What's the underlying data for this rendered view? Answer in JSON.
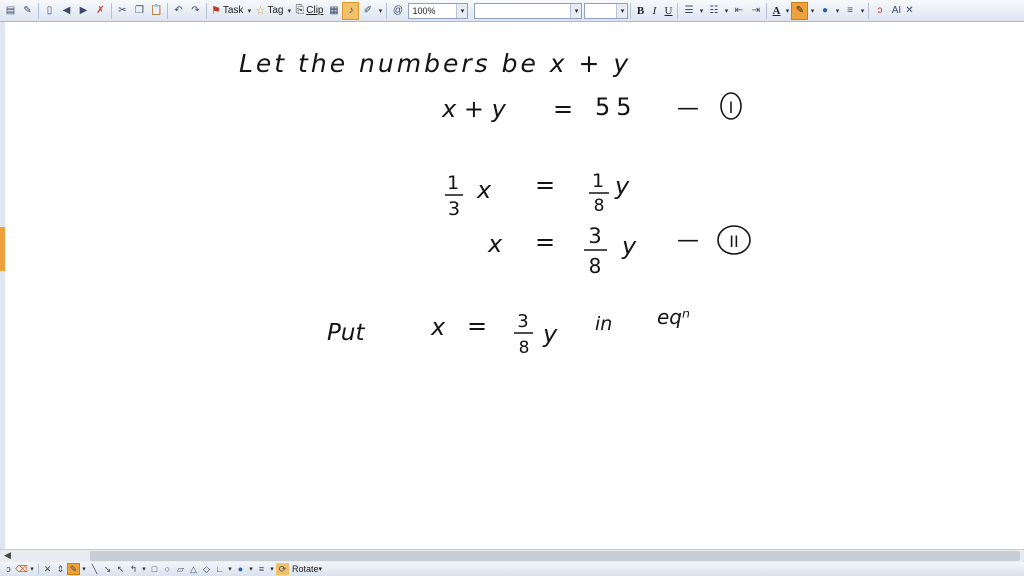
{
  "toolbar": {
    "task_label": "Task",
    "tag_label": "Tag",
    "clip_label": "Clip",
    "zoom_value": "100%",
    "font_name_value": "",
    "font_size_value": "",
    "bold_label": "B",
    "italic_label": "I",
    "underline_label": "U",
    "font_color_label": "A",
    "ai_label": "AI",
    "accent_color": "#f0a23a"
  },
  "notes": {
    "line1": "Let the numbers be x + y",
    "eq1": {
      "lhs": "x + y",
      "equals": "=",
      "rhs": "55",
      "dash": "—",
      "label": "I"
    },
    "eq2": {
      "lhs_num": "1",
      "lhs_den": "3",
      "lhs_var": "x",
      "equals": "=",
      "rhs_num": "1",
      "rhs_den": "8",
      "rhs_var": "y"
    },
    "eq3": {
      "lhs": "x",
      "equals": "=",
      "rhs_num": "3",
      "rhs_den": "8",
      "rhs_var": "y",
      "dash": "—",
      "label": "II"
    },
    "line4": {
      "put": "Put",
      "lhs": "x",
      "equals": "=",
      "num": "3",
      "den": "8",
      "var": "y",
      "in": "in",
      "eqn": "eqⁿ"
    }
  },
  "bottom": {
    "rotate_label": "Rotate"
  }
}
